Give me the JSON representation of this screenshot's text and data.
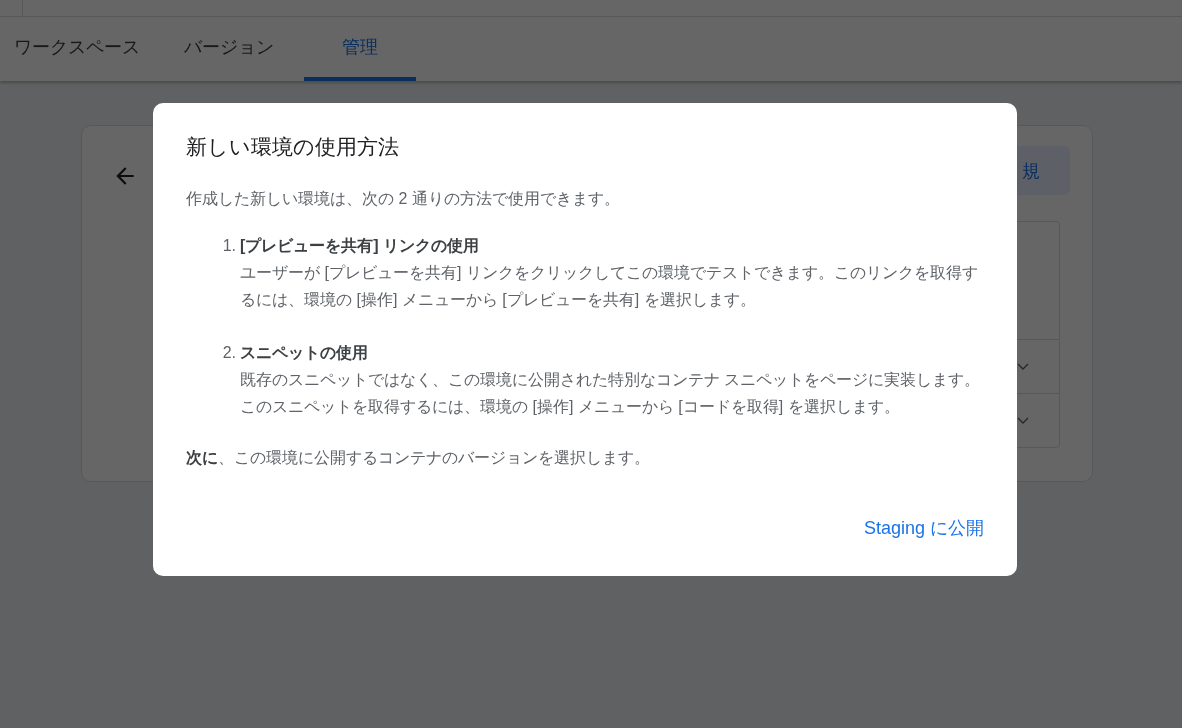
{
  "tabs": [
    {
      "label": "ワークスペース",
      "selected": false
    },
    {
      "label": "バージョン",
      "selected": false
    },
    {
      "label": "管理",
      "selected": true
    }
  ],
  "card": {
    "new_button": "規",
    "rows": [
      {
        "kind": "plain"
      },
      {
        "kind": "dropdown"
      },
      {
        "kind": "dropdown"
      }
    ]
  },
  "dialog": {
    "title": "新しい環境の使用方法",
    "intro": "作成した新しい環境は、次の 2 通りの方法で使用できます。",
    "steps": [
      {
        "number": "1.",
        "title": "[プレビューを共有] リンクの使用",
        "body": "ユーザーが [プレビューを共有] リンクをクリックしてこの環境でテストできます。このリンクを取得するには、環境の [操作] メニューから [プレビューを共有] を選択します。"
      },
      {
        "number": "2.",
        "title": "スニペットの使用",
        "body": "既存のスニペットではなく、この環境に公開された特別なコンテナ スニペットをページに実装します。このスニペットを取得するには、環境の [操作] メニューから [コードを取得] を選択します。"
      }
    ],
    "footer_note": "**次に**、この環境に公開するコンテナのバージョンを選択します。",
    "action": "Staging に公開"
  }
}
